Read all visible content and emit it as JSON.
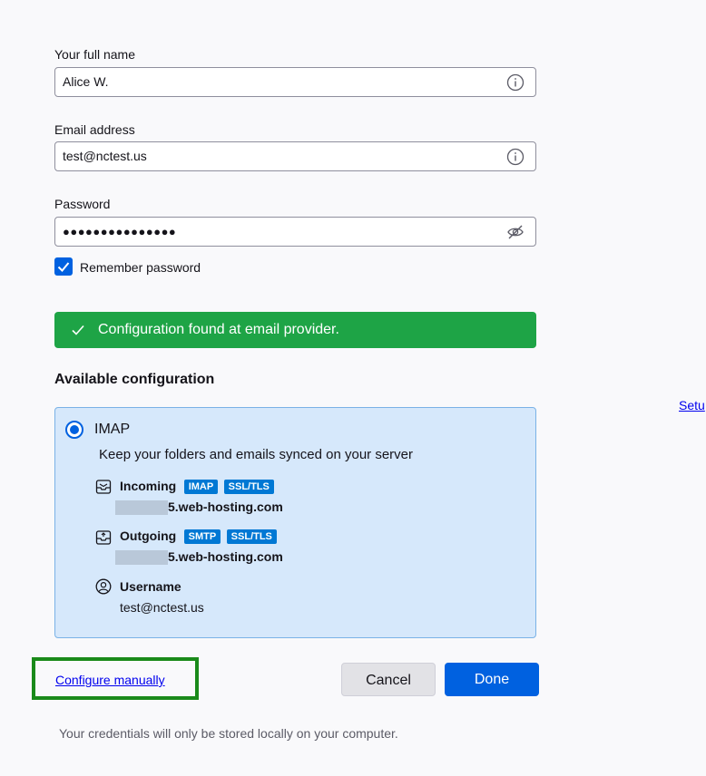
{
  "form": {
    "name_label": "Your full name",
    "name_value": "Alice W.",
    "email_label": "Email address",
    "email_value": "test@nctest.us",
    "password_label": "Password",
    "password_value": "●●●●●●●●●●●●●●●",
    "remember_label": "Remember password",
    "remember_checked": true
  },
  "banner": {
    "message": "Configuration found at email provider."
  },
  "available": {
    "title": "Available configuration",
    "protocol": "IMAP",
    "description": "Keep your folders and emails synced on your server",
    "incoming": {
      "label": "Incoming",
      "badges": [
        "IMAP",
        "SSL/TLS"
      ],
      "host_suffix": "5.web-hosting.com"
    },
    "outgoing": {
      "label": "Outgoing",
      "badges": [
        "SMTP",
        "SSL/TLS"
      ],
      "host_suffix": "5.web-hosting.com"
    },
    "username": {
      "label": "Username",
      "value": "test@nctest.us"
    }
  },
  "actions": {
    "configure_manually": "Configure manually",
    "cancel": "Cancel",
    "done": "Done"
  },
  "footer": {
    "note": "Your credentials will only be stored locally on your computer."
  },
  "side": {
    "link": "Setu"
  },
  "colors": {
    "accent": "#0061e0",
    "success": "#1ea446",
    "config_bg": "#d6e8fb",
    "highlight": "#1a8a1a"
  }
}
